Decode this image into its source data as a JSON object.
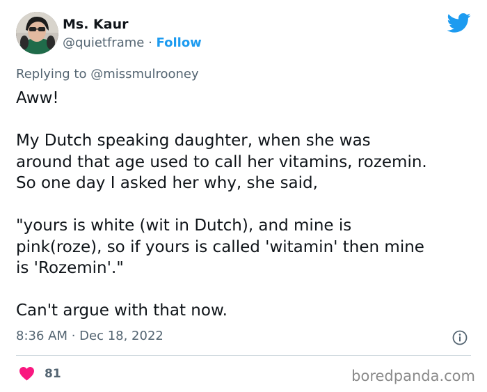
{
  "author": {
    "display_name": "Ms. Kaur",
    "handle": "@quietframe",
    "separator": "·",
    "follow_label": "Follow"
  },
  "reply": {
    "prefix": "Replying to",
    "mention": "@missmulrooney"
  },
  "tweet": {
    "paragraphs": [
      "Aww!",
      "My Dutch speaking daughter, when she was\naround that age used to call her vitamins, rozemin.\nSo one day I asked her why, she said,",
      "\"yours is white (wit in Dutch), and mine is\npink(roze), so if yours is called 'witamin' then mine\nis 'Rozemin'.\"",
      "Can't argue with that now."
    ],
    "timestamp": "8:36 AM · Dec 18, 2022"
  },
  "engagement": {
    "likes": "81"
  },
  "watermark": "boredpanda.com",
  "icons": {
    "brand": "twitter-bird-icon",
    "info": "info-icon",
    "like": "heart-icon"
  },
  "colors": {
    "accent": "#1d9bf0",
    "heart": "#f91880",
    "secondary_text": "#536471",
    "primary_text": "#0f1419"
  }
}
